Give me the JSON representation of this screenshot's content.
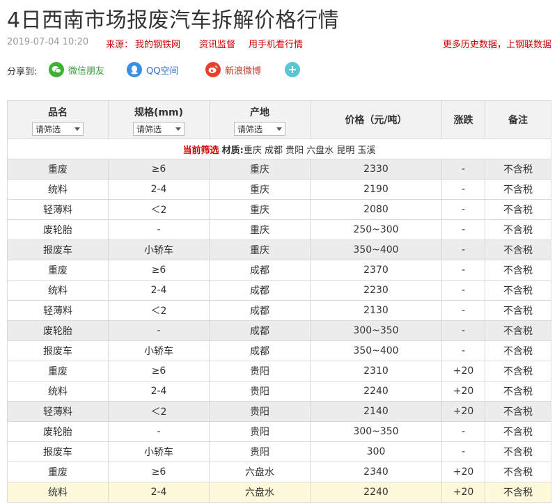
{
  "title": "4日西南市场报废汽车拆解价格行情",
  "meta": {
    "date": "2019-07-04 10:20",
    "source_label": "来源：",
    "source_name": "我的钢铁网",
    "link1": "资讯监督",
    "link2": "用手机看行情",
    "right_link": "更多历史数据，上钢联数据"
  },
  "share": {
    "label": "分享到:",
    "wechat": "微信朋友",
    "qq": "QQ空间",
    "weibo": "新浪微博"
  },
  "table": {
    "headers": {
      "name": "品名",
      "spec": "规格(mm)",
      "origin": "产地",
      "price": "价格（元/吨）",
      "change": "涨跌",
      "note": "备注"
    },
    "select_placeholder": "请筛选",
    "filter": {
      "label": "当前筛选",
      "material_label": "材质:",
      "values": "重庆 成都 贵阳 六盘水 昆明 玉溪"
    },
    "rows": [
      {
        "name": "重废",
        "spec": "≥6",
        "origin": "重庆",
        "price": "2330",
        "change": "-",
        "note": "不含税",
        "style": "gray"
      },
      {
        "name": "统料",
        "spec": "2-4",
        "origin": "重庆",
        "price": "2190",
        "change": "-",
        "note": "不含税",
        "style": ""
      },
      {
        "name": "轻薄料",
        "spec": "＜2",
        "origin": "重庆",
        "price": "2080",
        "change": "-",
        "note": "不含税",
        "style": ""
      },
      {
        "name": "废轮胎",
        "spec": "-",
        "origin": "重庆",
        "price": "250~300",
        "change": "-",
        "note": "不含税",
        "style": ""
      },
      {
        "name": "报废车",
        "spec": "小轿车",
        "origin": "重庆",
        "price": "350~400",
        "change": "-",
        "note": "不含税",
        "style": "gray"
      },
      {
        "name": "重废",
        "spec": "≥6",
        "origin": "成都",
        "price": "2370",
        "change": "-",
        "note": "不含税",
        "style": ""
      },
      {
        "name": "统料",
        "spec": "2-4",
        "origin": "成都",
        "price": "2230",
        "change": "-",
        "note": "不含税",
        "style": ""
      },
      {
        "name": "轻薄料",
        "spec": "＜2",
        "origin": "成都",
        "price": "2130",
        "change": "-",
        "note": "不含税",
        "style": ""
      },
      {
        "name": "废轮胎",
        "spec": "-",
        "origin": "成都",
        "price": "300~350",
        "change": "-",
        "note": "不含税",
        "style": "gray"
      },
      {
        "name": "报废车",
        "spec": "小轿车",
        "origin": "成都",
        "price": "350~400",
        "change": "-",
        "note": "不含税",
        "style": ""
      },
      {
        "name": "重废",
        "spec": "≥6",
        "origin": "贵阳",
        "price": "2310",
        "change": "+20",
        "note": "不含税",
        "style": ""
      },
      {
        "name": "统料",
        "spec": "2-4",
        "origin": "贵阳",
        "price": "2240",
        "change": "+20",
        "note": "不含税",
        "style": ""
      },
      {
        "name": "轻薄料",
        "spec": "＜2",
        "origin": "贵阳",
        "price": "2140",
        "change": "+20",
        "note": "不含税",
        "style": "gray"
      },
      {
        "name": "废轮胎",
        "spec": "-",
        "origin": "贵阳",
        "price": "300~350",
        "change": "-",
        "note": "不含税",
        "style": ""
      },
      {
        "name": "报废车",
        "spec": "小轿车",
        "origin": "贵阳",
        "price": "300",
        "change": "-",
        "note": "不含税",
        "style": ""
      },
      {
        "name": "重废",
        "spec": "≥6",
        "origin": "六盘水",
        "price": "2340",
        "change": "+20",
        "note": "不含税",
        "style": ""
      },
      {
        "name": "统料",
        "spec": "2-4",
        "origin": "六盘水",
        "price": "2240",
        "change": "+20",
        "note": "不含税",
        "style": "hl"
      }
    ]
  }
}
